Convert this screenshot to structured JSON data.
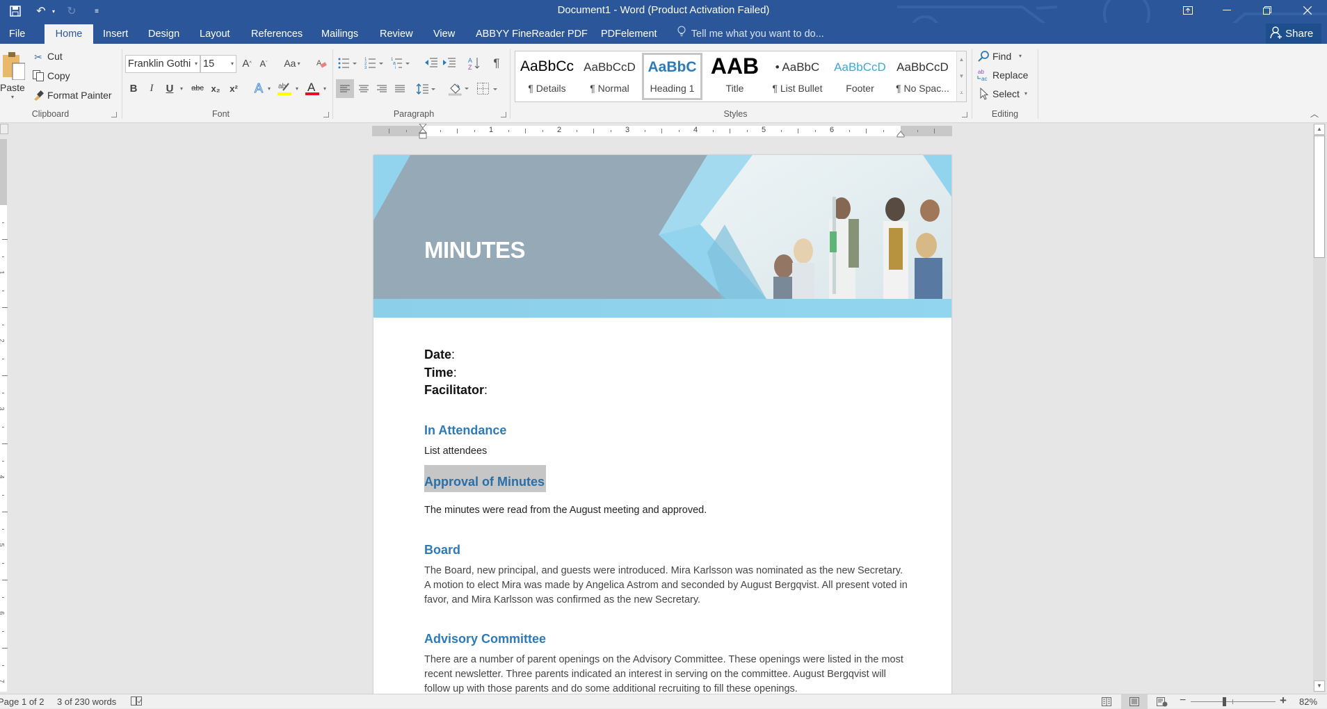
{
  "window": {
    "title": "Document1 - Word (Product Activation Failed)",
    "controls": {
      "ribbon_display": "ribbon-display-options-icon",
      "minimize": "minimize-icon",
      "restore": "restore-icon",
      "close": "close-icon"
    }
  },
  "quick_access": {
    "save": "save-icon",
    "undo": "undo-icon",
    "redo": "redo-icon",
    "customize": "customize-qat-icon"
  },
  "tabs": [
    {
      "label": "File",
      "active": false
    },
    {
      "label": "Home",
      "active": true
    },
    {
      "label": "Insert",
      "active": false
    },
    {
      "label": "Design",
      "active": false
    },
    {
      "label": "Layout",
      "active": false
    },
    {
      "label": "References",
      "active": false
    },
    {
      "label": "Mailings",
      "active": false
    },
    {
      "label": "Review",
      "active": false
    },
    {
      "label": "View",
      "active": false
    },
    {
      "label": "ABBYY FineReader PDF",
      "active": false
    },
    {
      "label": "PDFelement",
      "active": false
    }
  ],
  "tell_me": {
    "placeholder": "Tell me what you want to do..."
  },
  "share": {
    "label": "Share"
  },
  "ribbon": {
    "clipboard": {
      "label": "Clipboard",
      "paste": "Paste",
      "cut": "Cut",
      "copy": "Copy",
      "format_painter": "Format Painter"
    },
    "font": {
      "label": "Font",
      "font_name": "Franklin Gothi",
      "font_size": "15",
      "grow": "A",
      "shrink": "A",
      "change_case": "Aa",
      "bold": "B",
      "italic": "I",
      "underline": "U",
      "strikethrough": "abc",
      "subscript": "x₂",
      "superscript": "x²",
      "text_effects": "A",
      "highlight_color": "#ffff00",
      "font_color": "#e81123"
    },
    "paragraph": {
      "label": "Paragraph",
      "show_marks": "¶"
    },
    "styles": {
      "label": "Styles",
      "items": [
        {
          "preview": "AaBbCc",
          "name": "¶ Details",
          "selected": false
        },
        {
          "preview": "AaBbCcD",
          "name": "¶ Normal",
          "selected": false
        },
        {
          "preview": "AaBbC",
          "name": "Heading 1",
          "selected": true
        },
        {
          "preview": "AAB",
          "name": "Title",
          "selected": false
        },
        {
          "preview": "• AaBbC",
          "name": "¶ List Bullet",
          "selected": false
        },
        {
          "preview": "AaBbCcD",
          "name": "Footer",
          "selected": false
        },
        {
          "preview": "AaBbCcD",
          "name": "¶ No Spac...",
          "selected": false
        }
      ]
    },
    "editing": {
      "label": "Editing",
      "find": "Find",
      "replace": "Replace",
      "select": "Select"
    }
  },
  "ruler": {
    "numbers": [
      "1",
      "2",
      "3",
      "4",
      "5",
      "6"
    ]
  },
  "document": {
    "banner_title": "MINUTES",
    "fields": [
      {
        "label": "Date",
        "colon": ":"
      },
      {
        "label": "Time",
        "colon": ":"
      },
      {
        "label": "Facilitator",
        "colon": ":"
      }
    ],
    "sections": [
      {
        "heading": "In Attendance",
        "body": "List attendees",
        "selected": false
      },
      {
        "heading": "Approval of Minutes",
        "body": "The minutes were read from the August meeting and approved.",
        "selected": true
      },
      {
        "heading": "Board",
        "body": "The Board, new principal, and guests were introduced. Mira Karlsson was nominated as the new Secretary. A motion to elect Mira was made by Angelica Astrom and seconded by August Bergqvist. All present voted in favor, and Mira Karlsson was confirmed as the new Secretary.",
        "selected": false
      },
      {
        "heading": "Advisory Committee",
        "body": "There are a number of parent openings on the Advisory Committee. These openings were listed in the most recent newsletter. Three parents indicated an interest in serving on the committee. August Bergqvist will follow up with those parents and do some additional recruiting to fill these openings.",
        "selected": false
      }
    ]
  },
  "status": {
    "page": "Page 1 of 2",
    "words": "3 of 230 words",
    "proofing": "proofing-icon",
    "views": [
      "read-mode",
      "print-layout",
      "web-layout"
    ],
    "active_view": "print-layout",
    "zoom_minus": "−",
    "zoom_plus": "+",
    "zoom_level": "82%",
    "zoom_percent": 82
  }
}
